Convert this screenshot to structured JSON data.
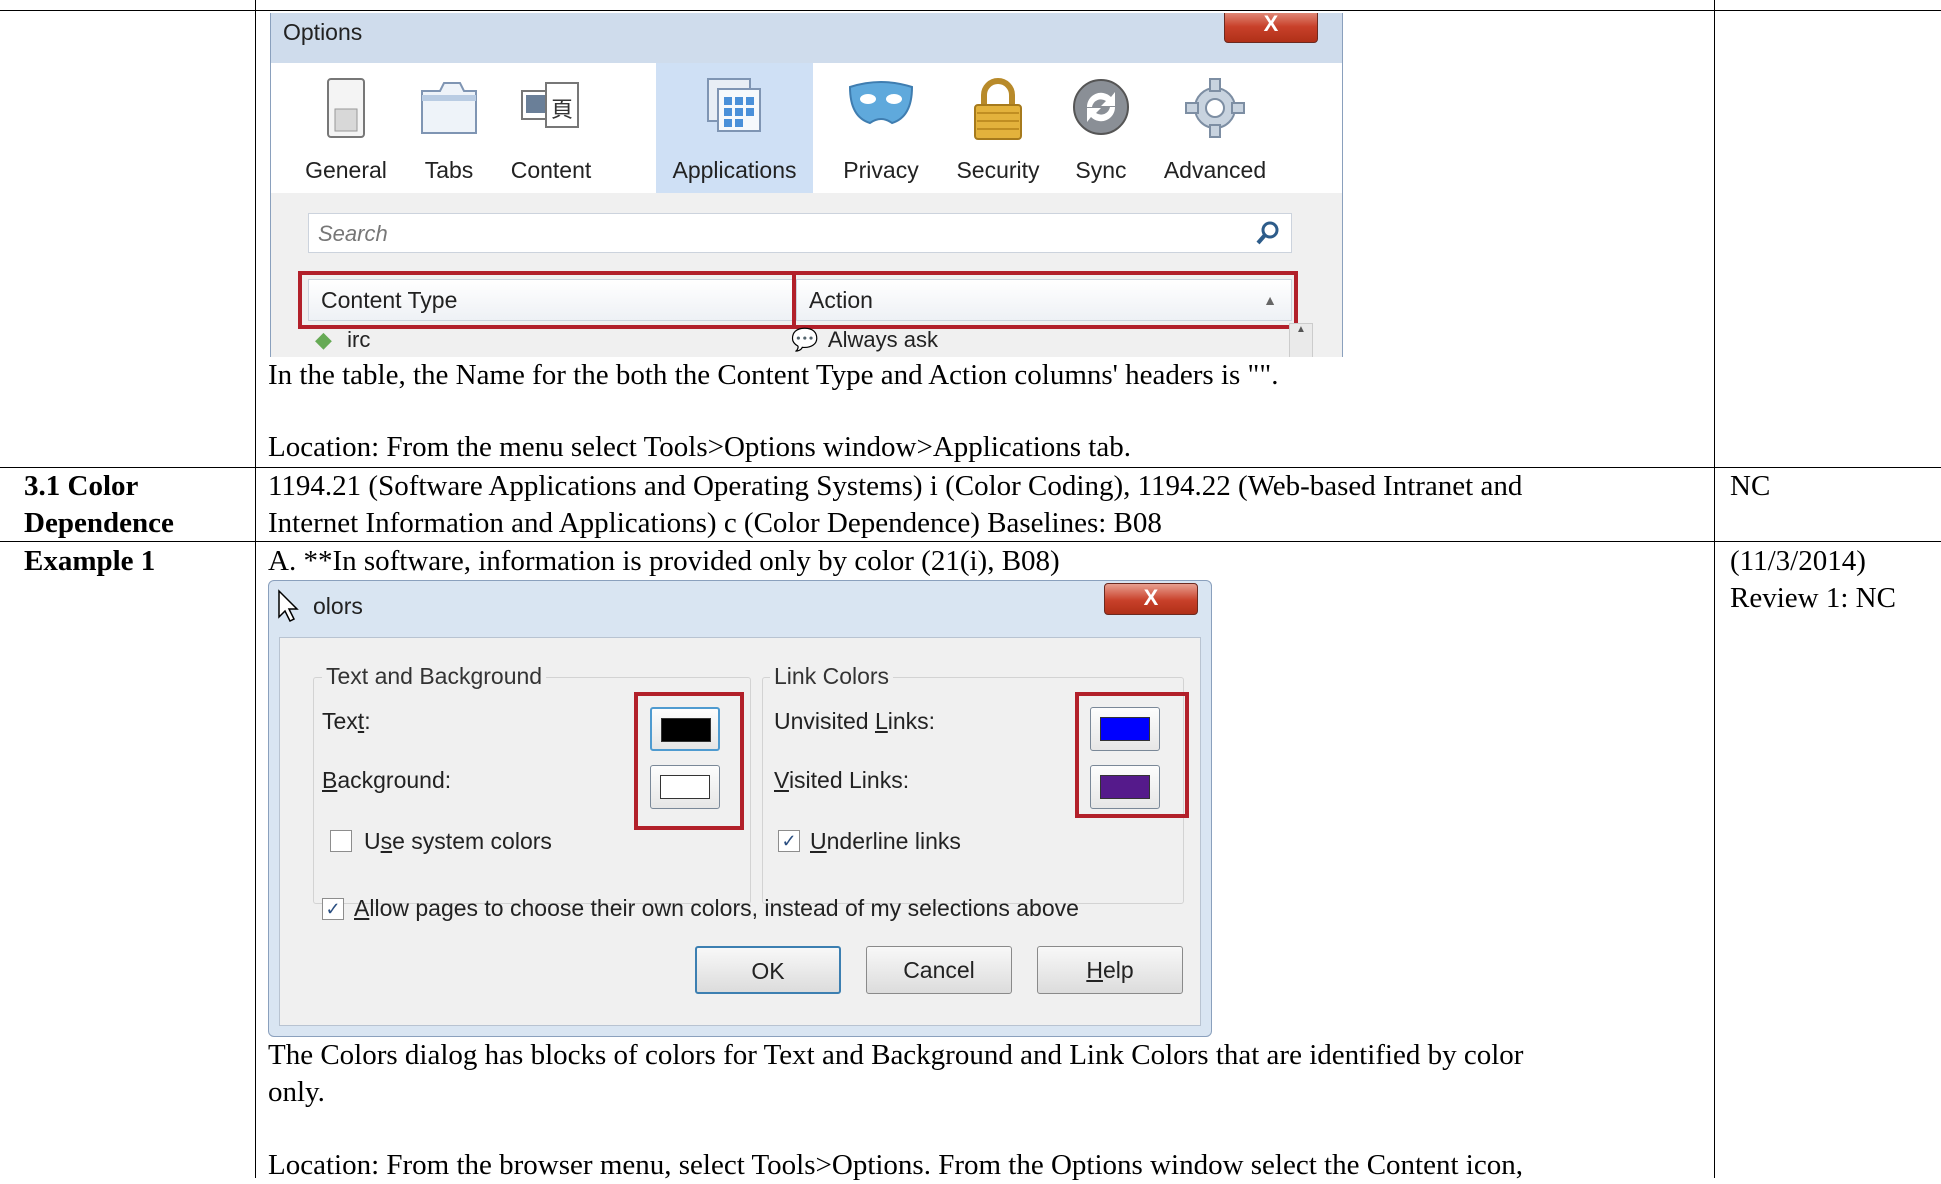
{
  "table": {
    "row1": {
      "caption": "In the table, the Name for the both the Content Type and Action columns' headers is \"\".",
      "location": "Location: From the menu select Tools>Options window>Applications tab."
    },
    "row2": {
      "label_line1": "3.1 Color",
      "label_line2": "Dependence",
      "text_line1": "1194.21 (Software Applications and Operating Systems) i (Color Coding), 1194.22 (Web-based Intranet and",
      "text_line2": "Internet Information and Applications) c (Color Dependence) Baselines: B08",
      "status": "NC"
    },
    "row3": {
      "label": "Example 1",
      "heading": "A. **In software, information is provided only by color (21(i), B08)",
      "date": "(11/3/2014)",
      "review": "Review 1: NC",
      "caption_line1": "The Colors dialog has blocks of colors for Text and Background and Link Colors that are identified by color",
      "caption_line2": "only.",
      "location": "Location: From the browser menu, select Tools>Options. From the Options window select the Content icon,"
    }
  },
  "options_dialog": {
    "title": "Options",
    "close_label": "X",
    "toolbar": [
      {
        "label": "General",
        "icon": "general-icon"
      },
      {
        "label": "Tabs",
        "icon": "tabs-icon"
      },
      {
        "label": "Content",
        "icon": "content-icon"
      },
      {
        "label": "Applications",
        "icon": "applications-icon",
        "selected": true
      },
      {
        "label": "Privacy",
        "icon": "privacy-mask-icon"
      },
      {
        "label": "Security",
        "icon": "lock-icon"
      },
      {
        "label": "Sync",
        "icon": "sync-icon"
      },
      {
        "label": "Advanced",
        "icon": "gear-icon"
      }
    ],
    "search_placeholder": "Search",
    "col_content_type": "Content Type",
    "col_action": "Action",
    "row_type": "irc",
    "row_action": "Always ask"
  },
  "colors_dialog": {
    "title": "olors",
    "close_label": "X",
    "group_text_bg": "Text and Background",
    "group_links": "Link Colors",
    "text_label_pre": "Tex",
    "text_label_ul": "t",
    "text_label_post": ":",
    "background_label_ul": "B",
    "background_label_rest": "ackground:",
    "use_system_pre": "U",
    "use_system_ul": "s",
    "use_system_post": "e system colors",
    "unvisited_pre": "Unvisited ",
    "unvisited_ul": "L",
    "unvisited_post": "inks:",
    "visited_ul": "V",
    "visited_rest": "isited Links:",
    "underline_ul": "U",
    "underline_rest": "nderline links",
    "allow_ul": "A",
    "allow_rest": "llow pages to choose their own colors, instead of my selections above",
    "ok_label": "OK",
    "cancel_label": "Cancel",
    "help_ul": "H",
    "help_rest": "elp",
    "colors": {
      "text": "#000000",
      "background": "#ffffff",
      "unvisited": "#0000ff",
      "visited": "#551a8b",
      "highlight": "#b2202a"
    }
  }
}
